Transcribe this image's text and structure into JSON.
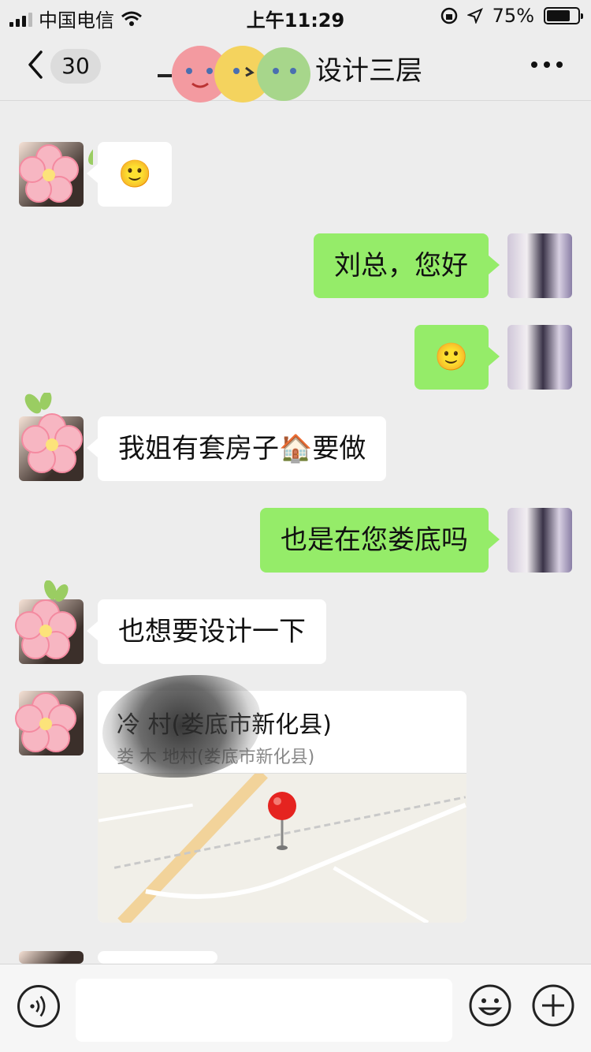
{
  "status_bar": {
    "carrier": "中国电信",
    "time": "上午11:29",
    "battery_percent": "75%",
    "battery_level": 0.75
  },
  "nav": {
    "back_icon": "chevron-left-icon",
    "unread_count": "30",
    "title": "设计三层",
    "more_icon": "more-dots-icon"
  },
  "messages": [
    {
      "side": "in",
      "text": "🙂"
    },
    {
      "side": "out",
      "text": "刘总，您好"
    },
    {
      "side": "out",
      "text": "🙂"
    },
    {
      "side": "in",
      "text": "我姐有套房子🏠要做"
    },
    {
      "side": "out",
      "text": "也是在您娄底吗"
    },
    {
      "side": "in",
      "text": "也想要设计一下"
    }
  ],
  "location": {
    "title": "冷 村(娄底市新化县)",
    "subtitle": "娄 木 地村(娄底市新化县)"
  },
  "input_bar": {
    "voice_icon": "voice-icon",
    "emoji_icon": "emoji-icon",
    "plus_icon": "plus-icon"
  },
  "colors": {
    "background": "#EDEDED",
    "outgoing_bubble": "#95EC69",
    "incoming_bubble": "#FFFFFF",
    "map_pin": "#E52420"
  }
}
